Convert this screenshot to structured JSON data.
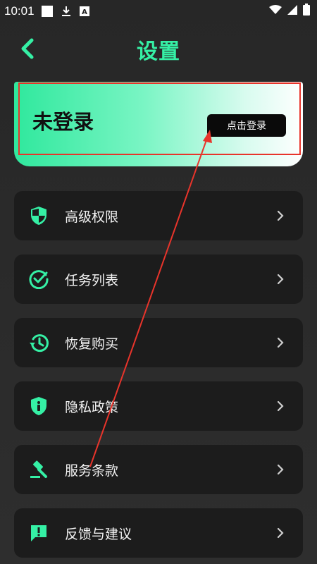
{
  "status_bar": {
    "time": "10:01",
    "icons": [
      "square-notification-icon",
      "download-icon",
      "a-notification-icon",
      "wifi-icon",
      "signal-icon",
      "battery-icon"
    ]
  },
  "header": {
    "title": "设置",
    "back_icon": "chevron-left-icon"
  },
  "login_card": {
    "status_text": "未登录",
    "button_label": "点击登录"
  },
  "menu": {
    "items": [
      {
        "label": "高级权限",
        "icon": "shield-icon"
      },
      {
        "label": "任务列表",
        "icon": "check-circle-icon"
      },
      {
        "label": "恢复购买",
        "icon": "history-icon"
      },
      {
        "label": "隐私政策",
        "icon": "info-shield-icon"
      },
      {
        "label": "服务条款",
        "icon": "gavel-icon"
      },
      {
        "label": "反馈与建议",
        "icon": "feedback-icon"
      }
    ]
  },
  "colors": {
    "accent": "#35f0a5",
    "background": "#2a2a2a",
    "card": "#1c1c1c",
    "annotation": "#e8342b"
  }
}
